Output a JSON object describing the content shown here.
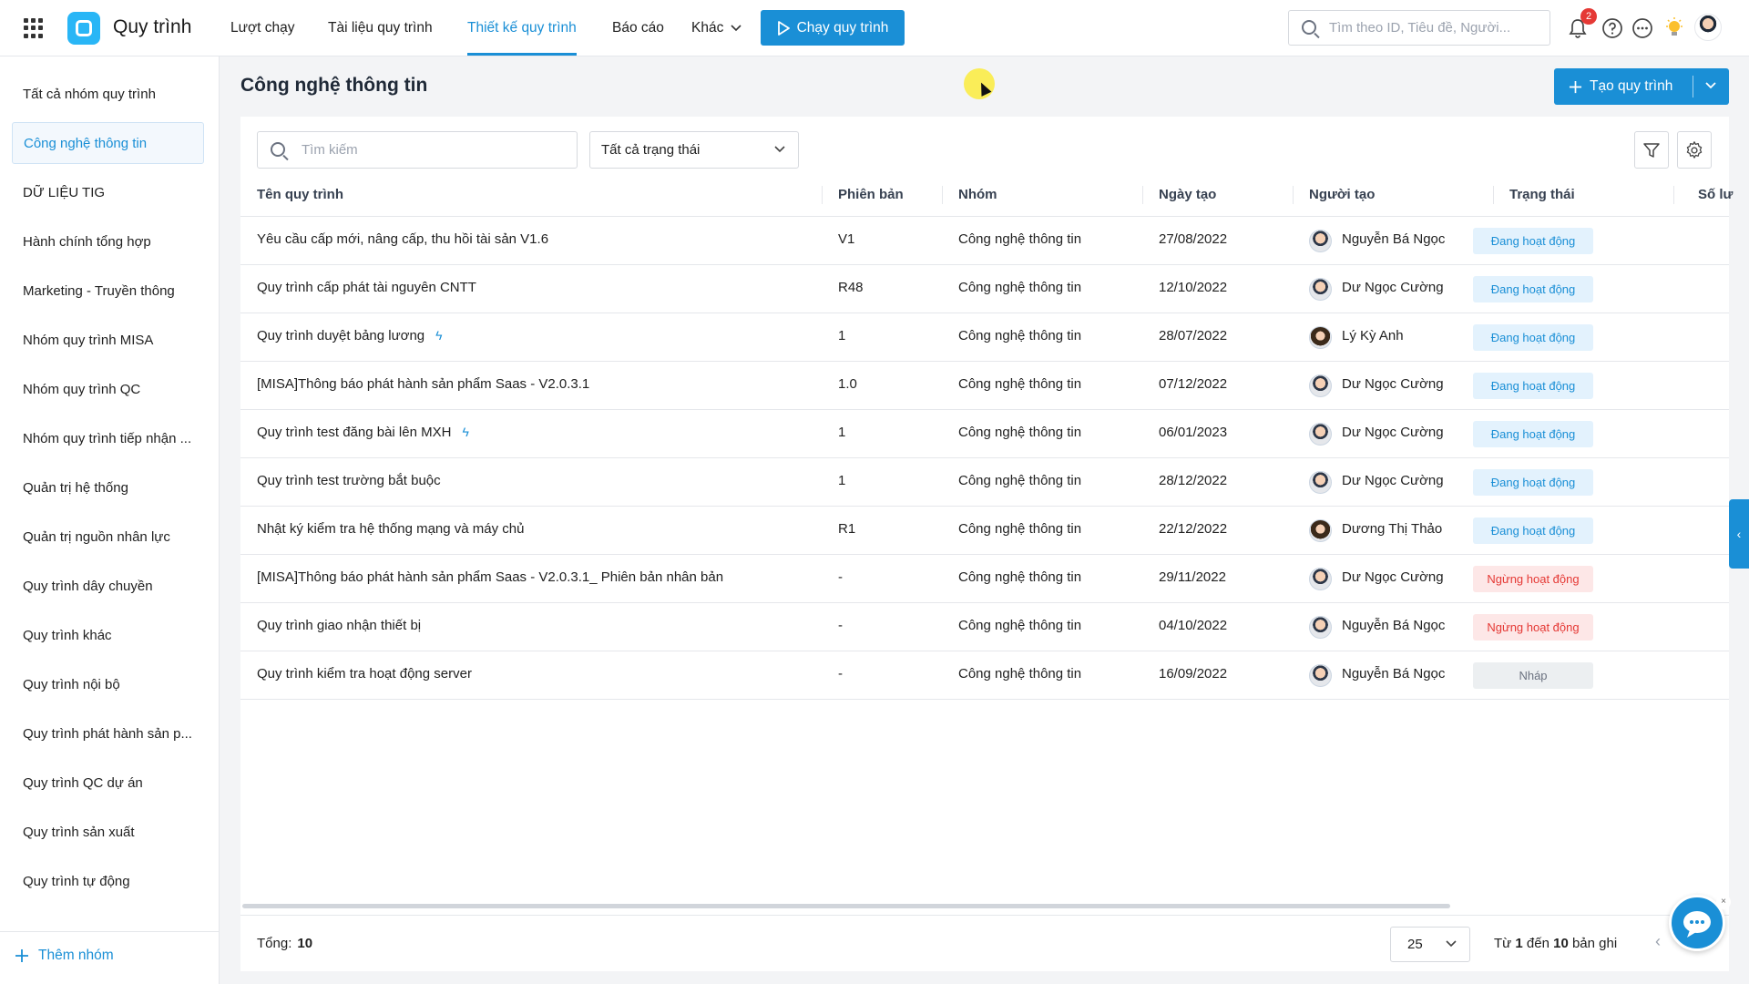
{
  "app": {
    "title": "Quy trình"
  },
  "nav": {
    "items": [
      "Lượt chạy",
      "Tài liệu quy trình",
      "Thiết kế quy trình",
      "Báo cáo",
      "Khác"
    ],
    "run_button": "Chạy quy trình"
  },
  "header": {
    "search_placeholder": "Tìm theo ID, Tiêu đề, Người...",
    "notification_count": "2"
  },
  "sidebar": {
    "items": [
      "Tất cả nhóm quy trình",
      "Công nghệ thông tin",
      "DỮ LIỆU TIG",
      "Hành chính tổng hợp",
      "Marketing - Truyền thông",
      "Nhóm quy trình MISA",
      "Nhóm quy trình QC",
      "Nhóm quy trình tiếp nhận ...",
      "Quản trị hệ thống",
      "Quản trị nguồn nhân lực",
      "Quy trình dây chuyền",
      "Quy trình khác",
      "Quy trình nội bộ",
      "Quy trình phát hành sản p...",
      "Quy trình QC dự án",
      "Quy trình sản xuất",
      "Quy trình tự động"
    ],
    "active_index": 1,
    "add_group": "Thêm nhóm"
  },
  "main": {
    "title": "Công nghệ thông tin",
    "create_button": "Tạo quy trình",
    "search_placeholder": "Tìm kiếm",
    "status_filter": "Tất cả trạng thái",
    "columns": [
      "Tên quy trình",
      "Phiên bản",
      "Nhóm",
      "Ngày tạo",
      "Người tạo",
      "Trạng thái",
      "Số lư"
    ],
    "rows": [
      {
        "name": "Yêu cầu cấp mới, nâng cấp, thu hồi tài sản V1.6",
        "bolt": false,
        "version": "V1",
        "group": "Công nghệ thông tin",
        "date": "27/08/2022",
        "creator": "Nguyễn Bá Ngọc",
        "status": "Đang hoạt động",
        "status_type": "active"
      },
      {
        "name": "Quy trình cấp phát tài nguyên CNTT",
        "bolt": false,
        "version": "R48",
        "group": "Công nghệ thông tin",
        "date": "12/10/2022",
        "creator": "Dư Ngọc Cường",
        "status": "Đang hoạt động",
        "status_type": "active"
      },
      {
        "name": "Quy trình duyệt bảng lương",
        "bolt": true,
        "version": "1",
        "group": "Công nghệ thông tin",
        "date": "28/07/2022",
        "creator": "Lý Kỳ Anh",
        "status": "Đang hoạt động",
        "status_type": "active"
      },
      {
        "name": "[MISA]Thông báo phát hành sản phẩm Saas - V2.0.3.1",
        "bolt": false,
        "version": "1.0",
        "group": "Công nghệ thông tin",
        "date": "07/12/2022",
        "creator": "Dư Ngọc Cường",
        "status": "Đang hoạt động",
        "status_type": "active"
      },
      {
        "name": "Quy trình test đăng bài lên MXH",
        "bolt": true,
        "version": "1",
        "group": "Công nghệ thông tin",
        "date": "06/01/2023",
        "creator": "Dư Ngọc Cường",
        "status": "Đang hoạt động",
        "status_type": "active"
      },
      {
        "name": "Quy trình test trường bắt buộc",
        "bolt": false,
        "version": "1",
        "group": "Công nghệ thông tin",
        "date": "28/12/2022",
        "creator": "Dư Ngọc Cường",
        "status": "Đang hoạt động",
        "status_type": "active"
      },
      {
        "name": "Nhật ký kiểm tra hệ thống mạng và máy chủ",
        "bolt": false,
        "version": "R1",
        "group": "Công nghệ thông tin",
        "date": "22/12/2022",
        "creator": "Dương Thị Thảo",
        "status": "Đang hoạt động",
        "status_type": "active"
      },
      {
        "name": "[MISA]Thông báo phát hành sản phẩm Saas - V2.0.3.1_ Phiên bản nhân bản",
        "bolt": false,
        "version": "-",
        "group": "Công nghệ thông tin",
        "date": "29/11/2022",
        "creator": "Dư Ngọc Cường",
        "status": "Ngừng hoạt động",
        "status_type": "stopped"
      },
      {
        "name": "Quy trình giao nhận thiết bị",
        "bolt": false,
        "version": "-",
        "group": "Công nghệ thông tin",
        "date": "04/10/2022",
        "creator": "Nguyễn Bá Ngọc",
        "status": "Ngừng hoạt động",
        "status_type": "stopped"
      },
      {
        "name": "Quy trình kiểm tra hoạt động server",
        "bolt": false,
        "version": "-",
        "group": "Công nghệ thông tin",
        "date": "16/09/2022",
        "creator": "Nguyễn Bá Ngọc",
        "status": "Nháp",
        "status_type": "draft"
      }
    ]
  },
  "footer": {
    "total_label": "Tổng:",
    "total_value": "10",
    "page_size": "25",
    "range_prefix": "Từ",
    "range_from": "1",
    "range_mid": "đến",
    "range_to": "10",
    "range_suffix": "bản ghi"
  },
  "colors": {
    "accent": "#1a8fd6",
    "active_bg": "#e3f2fd",
    "stopped_text": "#e53935",
    "draft_bg": "#eceff1"
  }
}
